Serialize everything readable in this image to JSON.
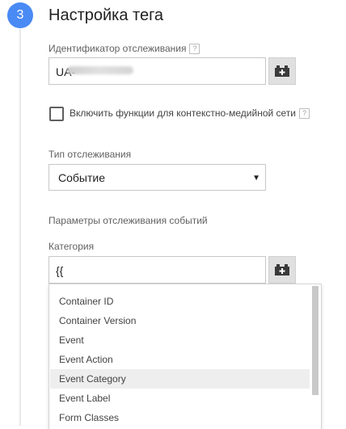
{
  "step": {
    "number": "3",
    "title": "Настройка тега"
  },
  "tracking_id": {
    "label": "Идентификатор отслеживания",
    "help": "?",
    "value": "UA-"
  },
  "display_features": {
    "label": "Включить функции для контекстно-медийной сети",
    "help": "?",
    "checked": false
  },
  "track_type": {
    "label": "Тип отслеживания",
    "selected": "Событие",
    "arrow": "▼"
  },
  "event_params": {
    "label": "Параметры отслеживания событий"
  },
  "category": {
    "label": "Категория",
    "value": "{{"
  },
  "dropdown": {
    "items": [
      "Container ID",
      "Container Version",
      "Event",
      "Event Action",
      "Event Category",
      "Event Label",
      "Form Classes"
    ],
    "highlighted_index": 4
  },
  "colors": {
    "accent": "#4a8af4"
  }
}
